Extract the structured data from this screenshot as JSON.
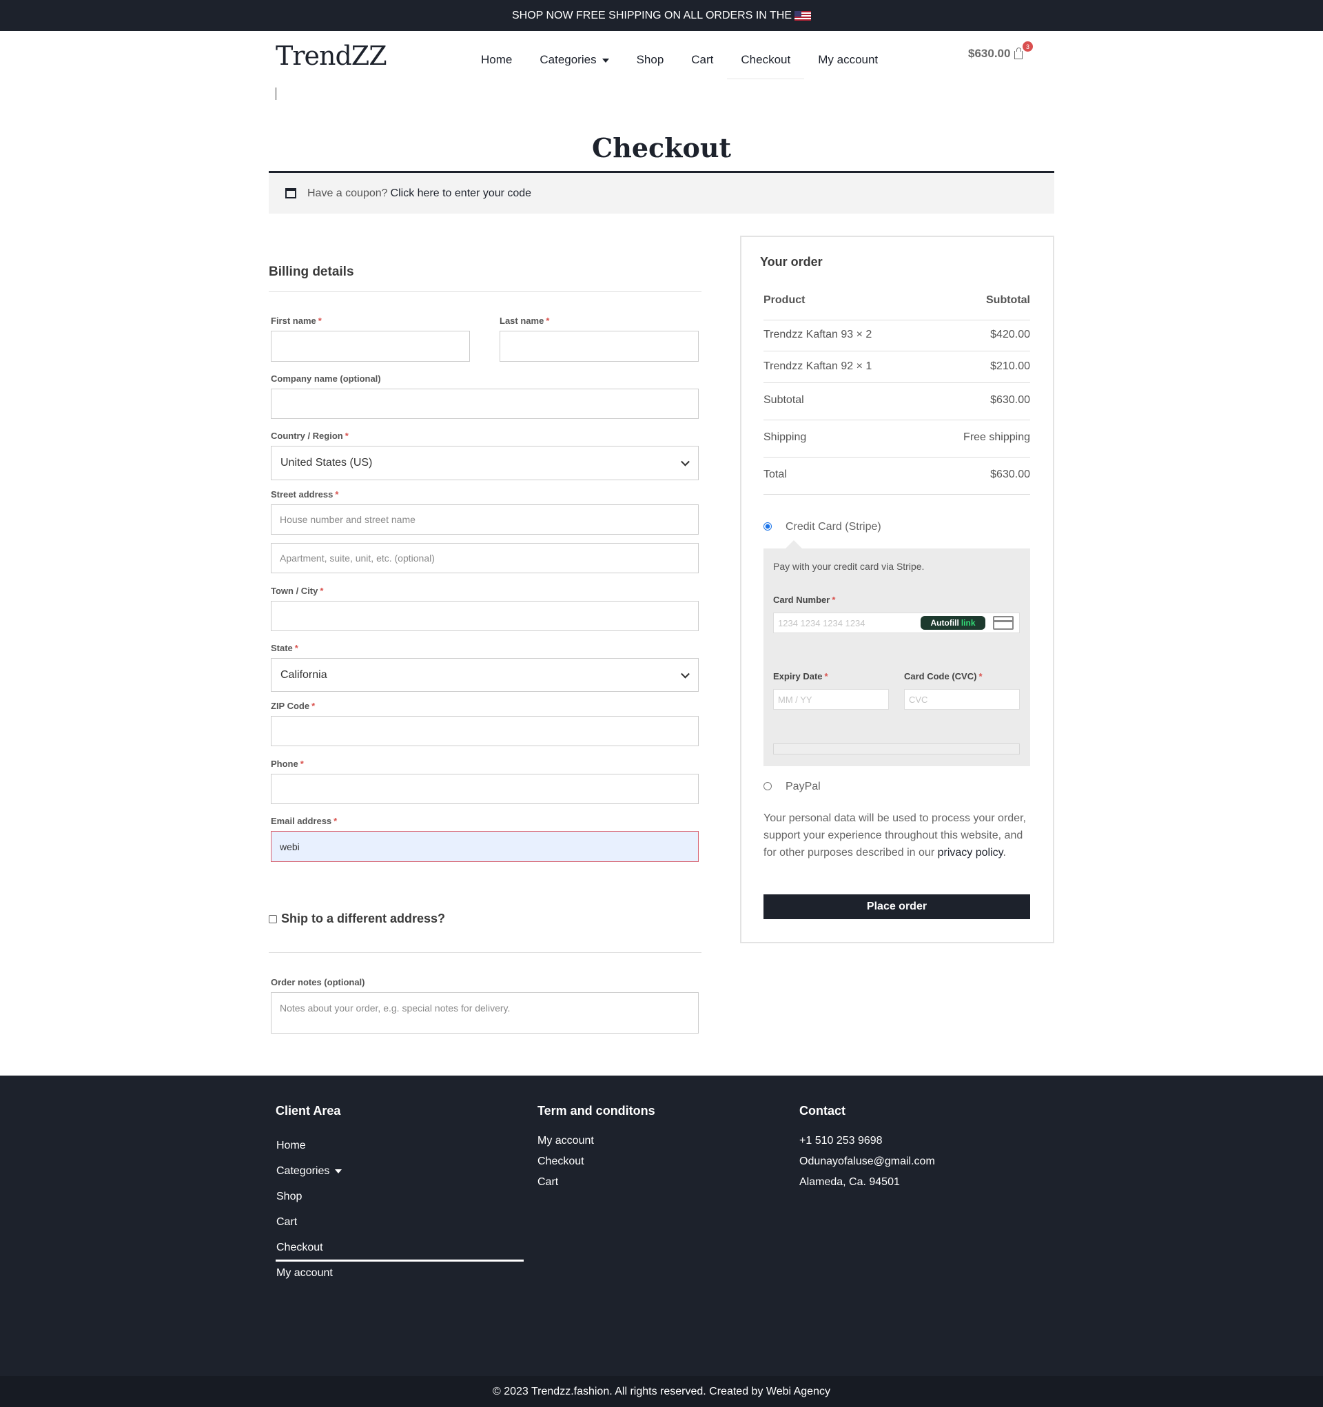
{
  "topbar": {
    "text": "SHOP NOW FREE SHIPPING ON ALL ORDERS IN THE"
  },
  "header": {
    "logo": "TrendZZ",
    "nav": [
      "Home",
      "Categories",
      "Shop",
      "Cart",
      "Checkout",
      "My account"
    ],
    "cart_total": "$630.00",
    "cart_count": "3"
  },
  "page": {
    "title": "Checkout"
  },
  "coupon": {
    "prompt": "Have a coupon?",
    "link": "Click here to enter your code"
  },
  "billing": {
    "title": "Billing details",
    "first_name_label": "First name",
    "last_name_label": "Last name",
    "company_label": "Company name (optional)",
    "country_label": "Country / Region",
    "country_value": "United States (US)",
    "street_label": "Street address",
    "street_placeholder": "House number and street name",
    "apt_placeholder": "Apartment, suite, unit, etc. (optional)",
    "city_label": "Town / City",
    "state_label": "State",
    "state_value": "California",
    "zip_label": "ZIP Code",
    "phone_label": "Phone",
    "email_label": "Email address",
    "email_value": "webi",
    "required_mark": "*"
  },
  "shipping": {
    "different_address_label": "Ship to a different address?"
  },
  "notes": {
    "label": "Order notes (optional)",
    "placeholder": "Notes about your order, e.g. special notes for delivery."
  },
  "order": {
    "title": "Your order",
    "col_product": "Product",
    "col_subtotal": "Subtotal",
    "items": [
      {
        "name": "Trendzz Kaftan 93 × 2",
        "price": "$420.00"
      },
      {
        "name": "Trendzz Kaftan 92 × 1",
        "price": "$210.00"
      }
    ],
    "subtotal_label": "Subtotal",
    "subtotal_value": "$630.00",
    "shipping_label": "Shipping",
    "shipping_value": "Free shipping",
    "total_label": "Total",
    "total_value": "$630.00"
  },
  "payment": {
    "stripe_label": "Credit Card (Stripe)",
    "stripe_desc": "Pay with your credit card via Stripe.",
    "card_number_label": "Card Number",
    "card_number_placeholder": "1234 1234 1234 1234",
    "autofill": "Autofill",
    "autofill_link": "link",
    "expiry_label": "Expiry Date",
    "expiry_placeholder": "MM / YY",
    "cvc_label": "Card Code (CVC)",
    "cvc_placeholder": "CVC",
    "paypal_label": "PayPal",
    "privacy_text": "Your personal data will be used to process your order, support your experience throughout this website, and for other purposes described in our",
    "privacy_link": "privacy policy",
    "place_order": "Place order"
  },
  "footer": {
    "client_area_title": "Client Area",
    "client_links": [
      "Home",
      "Categories",
      "Shop",
      "Cart",
      "Checkout",
      "My account"
    ],
    "terms_title": "Term and conditons",
    "terms_links": [
      "My account",
      "Checkout",
      "Cart"
    ],
    "contact_title": "Contact",
    "contact_lines": [
      "+1 510 253 9698",
      "Odunayofaluse@gmail.com",
      "Alameda, Ca. 94501"
    ],
    "copyright": "© 2023 Trendzz.fashion. All rights reserved. Created by Webi Agency"
  }
}
